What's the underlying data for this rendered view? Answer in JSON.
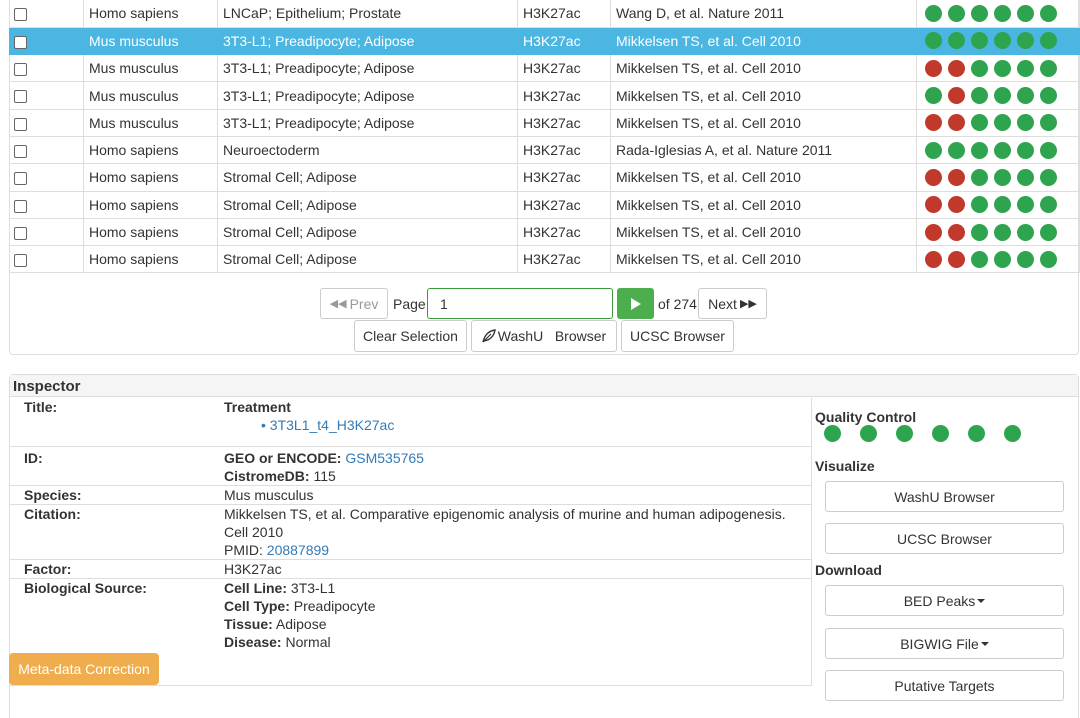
{
  "colors": {
    "green": "#2ea44f",
    "red": "#c0392b",
    "selected": "#4bb6e2",
    "orange": "#f0ad4e"
  },
  "rows": [
    {
      "species": "Homo sapiens",
      "source": "LNCaP; Epithelium; Prostate",
      "factor": "H3K27ac",
      "citation": "Wang D, et al. Nature 2011",
      "qc": [
        "green",
        "green",
        "green",
        "green",
        "green",
        "green"
      ],
      "selected": false
    },
    {
      "species": "Mus musculus",
      "source": "3T3-L1; Preadipocyte; Adipose",
      "factor": "H3K27ac",
      "citation": "Mikkelsen TS, et al. Cell 2010",
      "qc": [
        "green",
        "green",
        "green",
        "green",
        "green",
        "green"
      ],
      "selected": true
    },
    {
      "species": "Mus musculus",
      "source": "3T3-L1; Preadipocyte; Adipose",
      "factor": "H3K27ac",
      "citation": "Mikkelsen TS, et al. Cell 2010",
      "qc": [
        "red",
        "red",
        "green",
        "green",
        "green",
        "green"
      ],
      "selected": false
    },
    {
      "species": "Mus musculus",
      "source": "3T3-L1; Preadipocyte; Adipose",
      "factor": "H3K27ac",
      "citation": "Mikkelsen TS, et al. Cell 2010",
      "qc": [
        "green",
        "red",
        "green",
        "green",
        "green",
        "green"
      ],
      "selected": false
    },
    {
      "species": "Mus musculus",
      "source": "3T3-L1; Preadipocyte; Adipose",
      "factor": "H3K27ac",
      "citation": "Mikkelsen TS, et al. Cell 2010",
      "qc": [
        "red",
        "red",
        "green",
        "green",
        "green",
        "green"
      ],
      "selected": false
    },
    {
      "species": "Homo sapiens",
      "source": "Neuroectoderm",
      "factor": "H3K27ac",
      "citation": "Rada-Iglesias A, et al. Nature 2011",
      "qc": [
        "green",
        "green",
        "green",
        "green",
        "green",
        "green"
      ],
      "selected": false
    },
    {
      "species": "Homo sapiens",
      "source": "Stromal Cell; Adipose",
      "factor": "H3K27ac",
      "citation": "Mikkelsen TS, et al. Cell 2010",
      "qc": [
        "red",
        "red",
        "green",
        "green",
        "green",
        "green"
      ],
      "selected": false
    },
    {
      "species": "Homo sapiens",
      "source": "Stromal Cell; Adipose",
      "factor": "H3K27ac",
      "citation": "Mikkelsen TS, et al. Cell 2010",
      "qc": [
        "red",
        "red",
        "green",
        "green",
        "green",
        "green"
      ],
      "selected": false
    },
    {
      "species": "Homo sapiens",
      "source": "Stromal Cell; Adipose",
      "factor": "H3K27ac",
      "citation": "Mikkelsen TS, et al. Cell 2010",
      "qc": [
        "red",
        "red",
        "green",
        "green",
        "green",
        "green"
      ],
      "selected": false
    },
    {
      "species": "Homo sapiens",
      "source": "Stromal Cell; Adipose",
      "factor": "H3K27ac",
      "citation": "Mikkelsen TS, et al. Cell 2010",
      "qc": [
        "red",
        "red",
        "green",
        "green",
        "green",
        "green"
      ],
      "selected": false
    }
  ],
  "pagination": {
    "prev_label": "Prev",
    "page_label": "Page",
    "page_value": "1",
    "of_label": "of 274",
    "next_label": "Next",
    "clear_label": "Clear Selection",
    "washu_label": "WashU   Browser",
    "ucsc_label": "UCSC Browser",
    "prev_icon": "double-chevron-left-icon",
    "next_icon": "double-chevron-right-icon",
    "go_icon": "play-icon",
    "washu_icon": "leaf-icon"
  },
  "inspector": {
    "heading": "Inspector",
    "title_label": "Title:",
    "treatment_label": "Treatment",
    "treatment_item": "3T3L1_t4_H3K27ac",
    "id_label": "ID:",
    "geo_label": "GEO or ENCODE:",
    "geo_value": "GSM535765",
    "cistrome_label": "CistromeDB:",
    "cistrome_value": "115",
    "species_label": "Species:",
    "species_value": "Mus musculus",
    "citation_label": "Citation:",
    "citation_value": "Mikkelsen TS, et al. Comparative epigenomic analysis of murine and human adipogenesis. Cell 2010",
    "pmid_label": "PMID:",
    "pmid_value": "20887899",
    "factor_label": "Factor:",
    "factor_value": "H3K27ac",
    "biosource_label": "Biological Source:",
    "cell_line_label": "Cell Line:",
    "cell_line_value": "3T3-L1",
    "cell_type_label": "Cell Type:",
    "cell_type_value": "Preadipocyte",
    "tissue_label": "Tissue:",
    "tissue_value": "Adipose",
    "disease_label": "Disease:",
    "disease_value": "Normal",
    "meta_button": "Meta-data Correction"
  },
  "side": {
    "qc_heading": "Quality Control",
    "qc": [
      "green",
      "green",
      "green",
      "green",
      "green",
      "green"
    ],
    "visualize_heading": "Visualize",
    "washu_button": "WashU Browser",
    "ucsc_button": "UCSC Browser",
    "download_heading": "Download",
    "bed_button": "BED Peaks",
    "bigwig_button": "BIGWIG File",
    "targets_button": "Putative Targets"
  }
}
